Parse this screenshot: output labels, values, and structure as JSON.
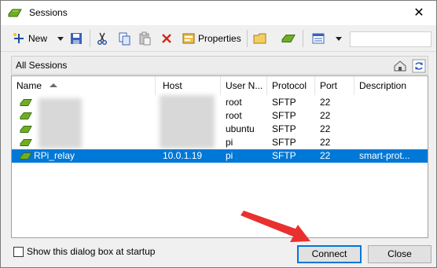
{
  "window": {
    "title": "Sessions",
    "close_glyph": "✕",
    "icon": "session-icon"
  },
  "toolbar": {
    "new_label": "New",
    "properties_label": "Properties",
    "icons": [
      "new-session-icon",
      "dropdown-arrow-icon",
      "save-icon",
      "cut-icon",
      "copy-icon",
      "paste-icon",
      "delete-icon",
      "properties-icon",
      "folder-icon",
      "session-icon",
      "view-icon",
      "dropdown-arrow-icon"
    ]
  },
  "folder_bar": {
    "label": "All Sessions",
    "icons": [
      "home-folder-icon",
      "refresh-icon"
    ]
  },
  "list": {
    "columns": [
      "Name",
      "Host",
      "User N...",
      "Protocol",
      "Port",
      "Description"
    ],
    "rows": [
      {
        "name": "",
        "host": "",
        "user": "root",
        "protocol": "SFTP",
        "port": "22",
        "description": "",
        "selected": false
      },
      {
        "name": "",
        "host": "",
        "user": "root",
        "protocol": "SFTP",
        "port": "22",
        "description": "",
        "selected": false
      },
      {
        "name": "",
        "host": "",
        "user": "ubuntu",
        "protocol": "SFTP",
        "port": "22",
        "description": "",
        "selected": false
      },
      {
        "name": "",
        "host": "",
        "user": "pi",
        "protocol": "SFTP",
        "port": "22",
        "description": "",
        "selected": false
      },
      {
        "name": "RPi_relay",
        "host": "10.0.1.19",
        "user": "pi",
        "protocol": "SFTP",
        "port": "22",
        "description": "smart-prot...",
        "selected": true
      }
    ]
  },
  "footer": {
    "startup_checkbox_label": "Show this dialog box at startup",
    "startup_checked": false,
    "connect_label": "Connect",
    "close_label": "Close"
  },
  "colors": {
    "selection": "#0078d7",
    "annotation_arrow": "#e8312f"
  }
}
